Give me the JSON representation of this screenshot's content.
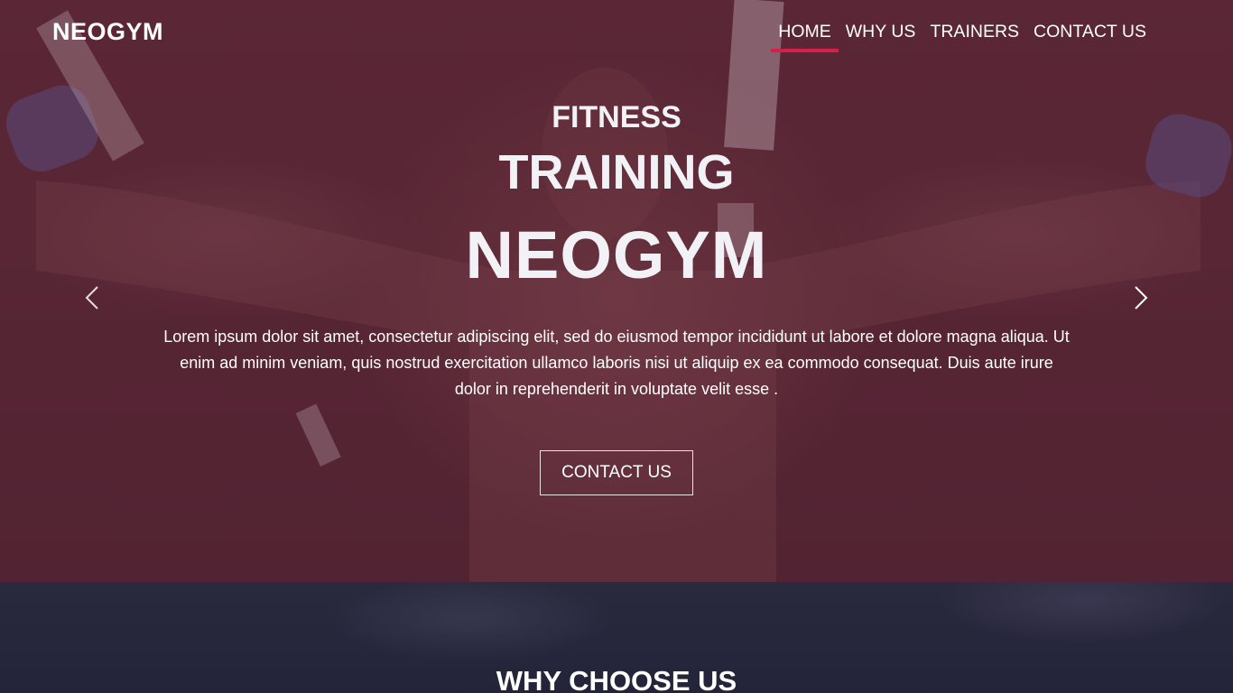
{
  "brand": {
    "logo": "NEOGYM"
  },
  "nav": {
    "items": [
      {
        "label": "HOME",
        "active": true
      },
      {
        "label": "WHY US",
        "active": false
      },
      {
        "label": "TRAINERS",
        "active": false
      },
      {
        "label": "CONTACT US",
        "active": false
      }
    ],
    "active_color": "#d6204a"
  },
  "hero": {
    "line1": "FITNESS",
    "line2": "TRAINING",
    "line3": "NEOGYM",
    "description": "Lorem ipsum dolor sit amet, consectetur adipiscing elit, sed do eiusmod tempor incididunt ut labore et dolore magna aliqua. Ut enim ad minim veniam, quis nostrud exercitation ullamco laboris nisi ut aliquip ex ea commodo consequat. Duis aute irure dolor in reprehenderit in voluptate velit esse .",
    "cta_label": "CONTACT US",
    "prev_icon": "chevron-left-icon",
    "next_icon": "chevron-right-icon",
    "overlay_color": "#5b2a38"
  },
  "why_section": {
    "title": "WHY CHOOSE US",
    "background_color": "#23233a"
  }
}
